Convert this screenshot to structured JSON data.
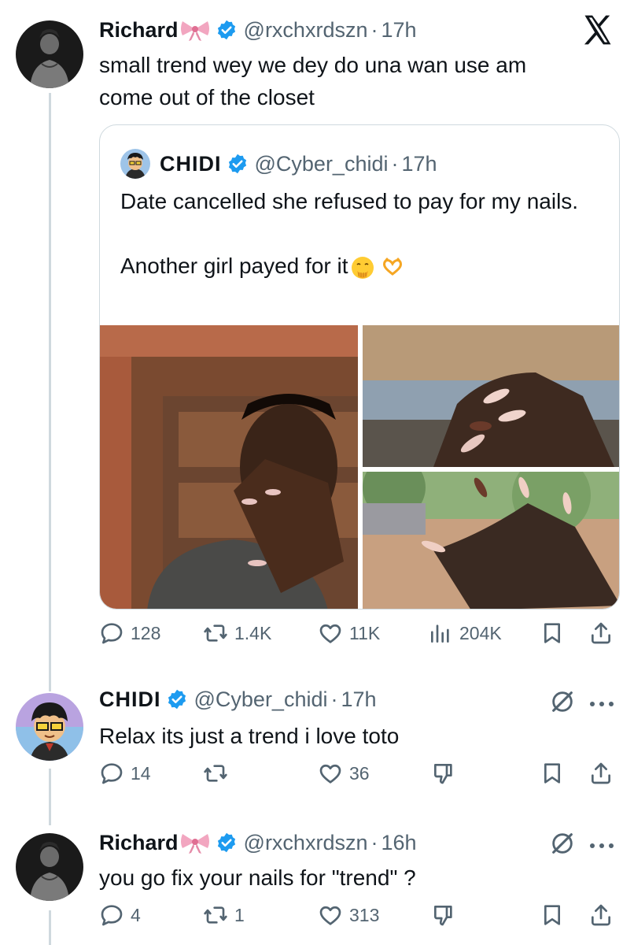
{
  "main_tweet": {
    "name": "Richard",
    "handle": "@rxchxrdszn",
    "time": "17h",
    "text": "small trend wey we dey do una wan use am\ncome out of the closet",
    "quote": {
      "name": "CHIDI",
      "handle": "@Cyber_chidi",
      "time": "17h",
      "text": "Date cancelled she refused to pay for my nails.\n\nAnother girl payed for it"
    },
    "stats": {
      "replies": "128",
      "reposts": "1.4K",
      "likes": "11K",
      "views": "204K"
    }
  },
  "replies": [
    {
      "name": "CHIDI",
      "handle": "@Cyber_chidi",
      "time": "17h",
      "text": "Relax its just a trend i love toto",
      "stats": {
        "replies": "14",
        "reposts": "",
        "likes": "36"
      }
    },
    {
      "name": "Richard",
      "handle": "@rxchxrdszn",
      "time": "16h",
      "text": "you go fix your nails for \"trend\" ?",
      "stats": {
        "replies": "4",
        "reposts": "1",
        "likes": "313"
      }
    }
  ],
  "colors": {
    "verified": "#1d9bf0",
    "muted": "#536471",
    "border": "#cfd9de"
  }
}
